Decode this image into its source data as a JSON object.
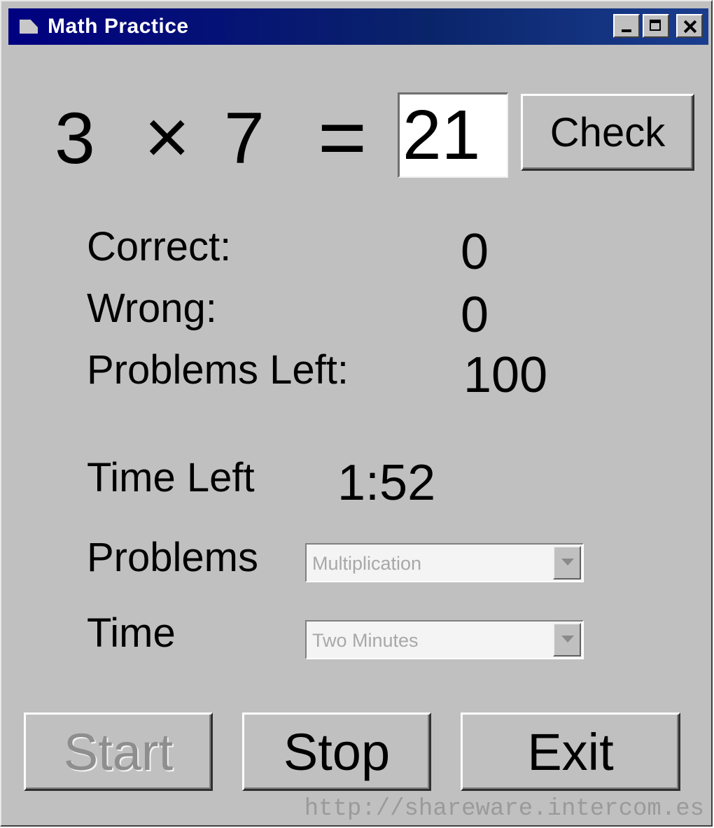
{
  "window": {
    "title": "Math Practice"
  },
  "problem": {
    "operand1": "3",
    "operator": "×",
    "operand2": "7",
    "equals": "="
  },
  "answer": {
    "value": "21"
  },
  "check_button": "Check",
  "stats": {
    "correct_label": "Correct:",
    "correct_value": "0",
    "wrong_label": "Wrong:",
    "wrong_value": "0",
    "left_label": "Problems Left:",
    "left_value": "100"
  },
  "timer": {
    "label": "Time Left",
    "value": "1:52"
  },
  "problems_select": {
    "label": "Problems",
    "selected": "Multiplication"
  },
  "time_select": {
    "label": "Time",
    "selected": "Two Minutes"
  },
  "buttons": {
    "start": "Start",
    "stop": "Stop",
    "exit": "Exit"
  },
  "watermark": "http://shareware.intercom.es"
}
